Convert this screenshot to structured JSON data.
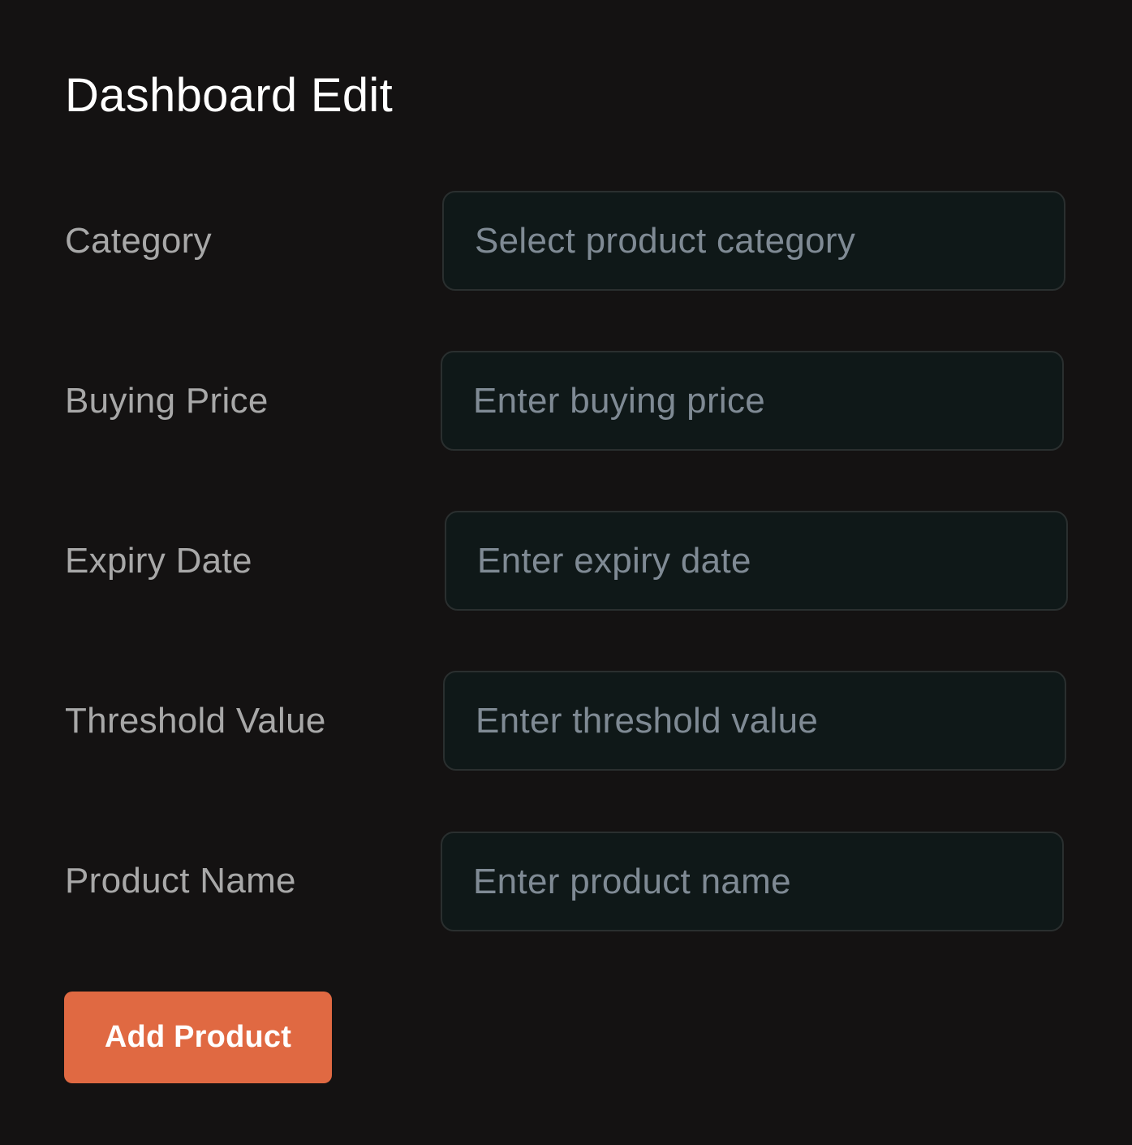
{
  "page": {
    "title": "Dashboard Edit"
  },
  "form": {
    "fields": [
      {
        "label": "Category",
        "placeholder": "Select product category"
      },
      {
        "label": "Buying Price",
        "placeholder": "Enter buying price"
      },
      {
        "label": "Expiry Date",
        "placeholder": "Enter expiry date"
      },
      {
        "label": "Threshold Value",
        "placeholder": "Enter threshold value"
      },
      {
        "label": "Product Name",
        "placeholder": "Enter product name"
      }
    ],
    "submit_label": "Add Product"
  },
  "colors": {
    "background": "#141212",
    "field_background": "#0f1818",
    "field_border": "#2a2f2f",
    "label_text": "#a8a8a8",
    "placeholder_text": "#7f8a94",
    "accent": "#e06942"
  }
}
